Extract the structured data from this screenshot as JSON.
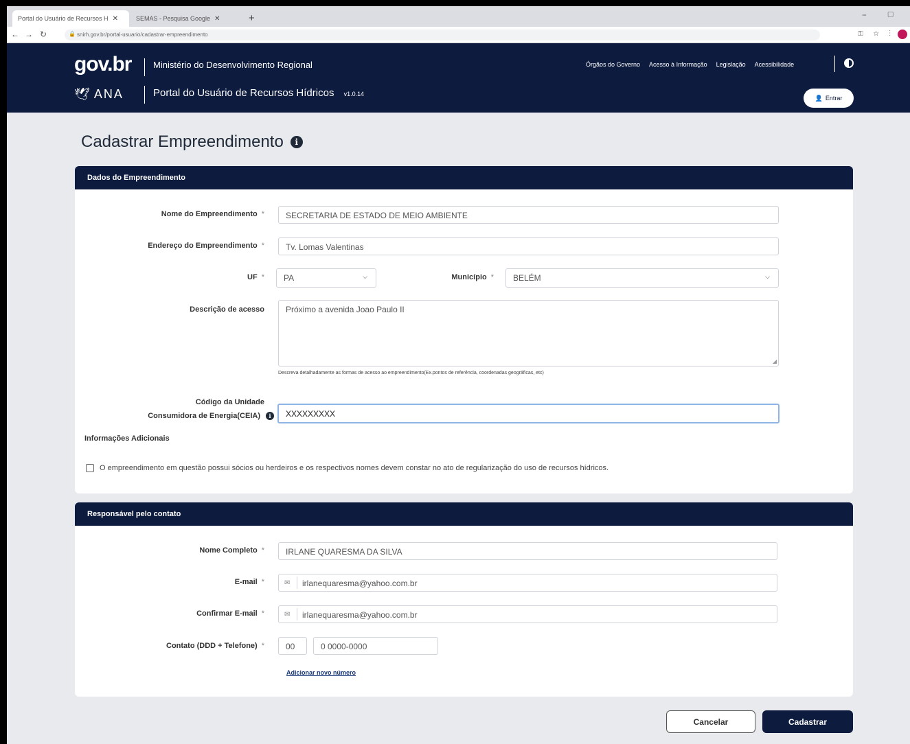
{
  "browser": {
    "tabs": [
      {
        "label": "Portal do Usuário de Recursos H"
      },
      {
        "label": "SEMAS - Pesquisa Google"
      }
    ],
    "url": "snirh.gov.br/portal-usuario/cadastrar-empreendimento",
    "new_tab": "+",
    "window_controls": "⎯ ▢"
  },
  "header": {
    "govbr_logo": "gov.br",
    "ministry": "Ministério do Desenvolvimento Regional",
    "ana_logo": "ANA",
    "portal_title": "Portal do Usuário de Recursos Hídricos",
    "version": "v1.0.14",
    "nav": [
      "Órgãos do Governo",
      "Acesso à Informação",
      "Legislação",
      "Acessibilidade"
    ],
    "login_label": "Entrar"
  },
  "page": {
    "title": "Cadastrar Empreendimento"
  },
  "empreendimento": {
    "section_title": "Dados do Empreendimento",
    "nome_label": "Nome do Empreendimento",
    "nome_value": "SECRETARIA DE ESTADO DE MEIO AMBIENTE",
    "endereco_label": "Endereço do Empreendimento",
    "endereco_value": "Tv. Lomas Valentinas",
    "uf_label": "UF",
    "uf_value": "PA",
    "municipio_label": "Município",
    "municipio_value": "BELÉM",
    "descricao_label": "Descrição de acesso",
    "descricao_value": "Próximo a avenida Joao Paulo II",
    "descricao_hint": "Descreva detalhadamente as formas de acesso ao empreendimento(Ex.pontos de referência, coordenadas geográficas, etc)",
    "ceia_label_line1": "Código da Unidade",
    "ceia_label_line2": "Consumidora de Energia(CEIA)",
    "ceia_value": "XXXXXXXXX",
    "required_mark": "*"
  },
  "adicionais": {
    "title": "Informações Adicionais",
    "checkbox_label": "O empreendimento em questão possui sócios ou herdeiros e os respectivos nomes devem constar no ato de regularização do uso de recursos hídricos."
  },
  "contato": {
    "section_title": "Responsável pelo contato",
    "nome_label": "Nome Completo",
    "nome_value": "IRLANE QUARESMA DA SILVA",
    "email_label": "E-mail",
    "email_value": "irlanequaresma@yahoo.com.br",
    "confirm_label": "Confirmar E-mail",
    "confirm_value": "irlanequaresma@yahoo.com.br",
    "telefone_label": "Contato (DDD + Telefone)",
    "ddd_value": "00",
    "telefone_value": "0 0000-0000",
    "add_number": "Adicionar novo número"
  },
  "actions": {
    "cancel": "Cancelar",
    "submit": "Cadastrar"
  }
}
